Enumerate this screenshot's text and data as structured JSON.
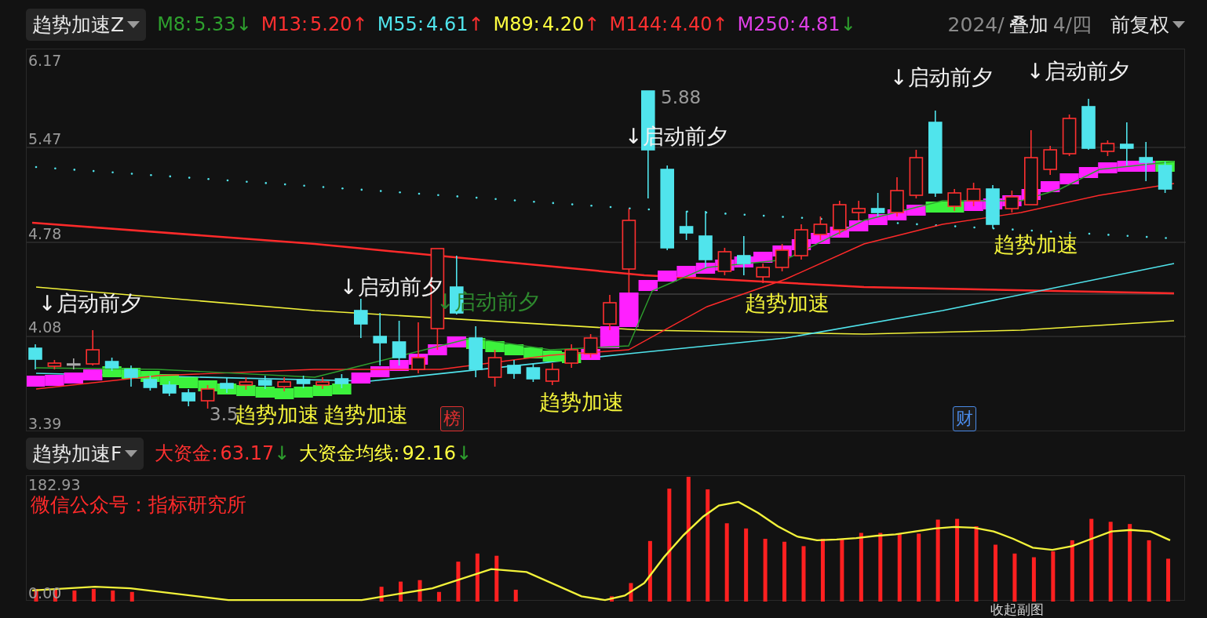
{
  "main_header": {
    "indicator": "趋势加速Z",
    "averages": [
      {
        "label": "M8:",
        "value": "5.33",
        "color": "#2ea02e",
        "arrow": {
          "text": "↓",
          "color": "#2ea02e"
        }
      },
      {
        "label": "M13:",
        "value": "5.20",
        "color": "#ff3030",
        "arrow": {
          "text": "↑",
          "color": "#ff3030"
        }
      },
      {
        "label": "M55:",
        "value": "4.61",
        "color": "#50e4ec",
        "arrow": {
          "text": "↑",
          "color": "#ff3030"
        }
      },
      {
        "label": "M89:",
        "value": "4.20",
        "color": "#ffff40",
        "arrow": {
          "text": "↑",
          "color": "#ff3030"
        }
      },
      {
        "label": "M144:",
        "value": "4.40",
        "color": "#ff3030",
        "arrow": {
          "text": "↑",
          "color": "#ff3030"
        }
      },
      {
        "label": "M250:",
        "value": "4.81",
        "color": "#e040e8",
        "arrow": {
          "text": "↓",
          "color": "#2ea02e"
        }
      }
    ],
    "date_head": "2024/",
    "date_tail": "4/四",
    "overlay": "叠加",
    "adjust": "前复权"
  },
  "price_chart": {
    "yticks": [
      "6.17",
      "5.47",
      "4.78",
      "4.08",
      "3.39"
    ],
    "high_label": "5.88",
    "low_label": "3.5",
    "labels": [
      {
        "text": "↓启动前夕",
        "kind": "signal"
      },
      {
        "text": "↓启动前夕",
        "kind": "signal"
      },
      {
        "text": "↓启动前夕",
        "kind": "faded"
      },
      {
        "text": "↓启动前夕",
        "kind": "signal"
      },
      {
        "text": "↓启动前夕",
        "kind": "signal"
      },
      {
        "text": "↓启动前夕",
        "kind": "signal"
      },
      {
        "text": "趋势加速",
        "kind": "trend"
      },
      {
        "text": "趋势加速",
        "kind": "trend"
      },
      {
        "text": "趋势加速",
        "kind": "trend"
      },
      {
        "text": "趋势加速",
        "kind": "trend"
      },
      {
        "text": "趋势加速",
        "kind": "trend"
      }
    ],
    "markers": [
      {
        "text": "榜",
        "color": "#e03030"
      },
      {
        "text": "财",
        "color": "#4a8ae8"
      }
    ]
  },
  "sub_header": {
    "indicator": "趋势加速F",
    "readings": [
      {
        "label": "大资金:",
        "value": "63.17",
        "color": "#ff3030",
        "arrow": {
          "text": "↓",
          "color": "#2ea02e"
        }
      },
      {
        "label": "大资金均线:",
        "value": "92.16",
        "color": "#ffff40",
        "arrow": {
          "text": "↓",
          "color": "#2ea02e"
        }
      }
    ]
  },
  "sub_chart": {
    "yticks": [
      "182.93",
      "0.00"
    ],
    "note": "微信公众号：指标研究所"
  },
  "footer": {
    "collapse": "收起副图"
  }
}
